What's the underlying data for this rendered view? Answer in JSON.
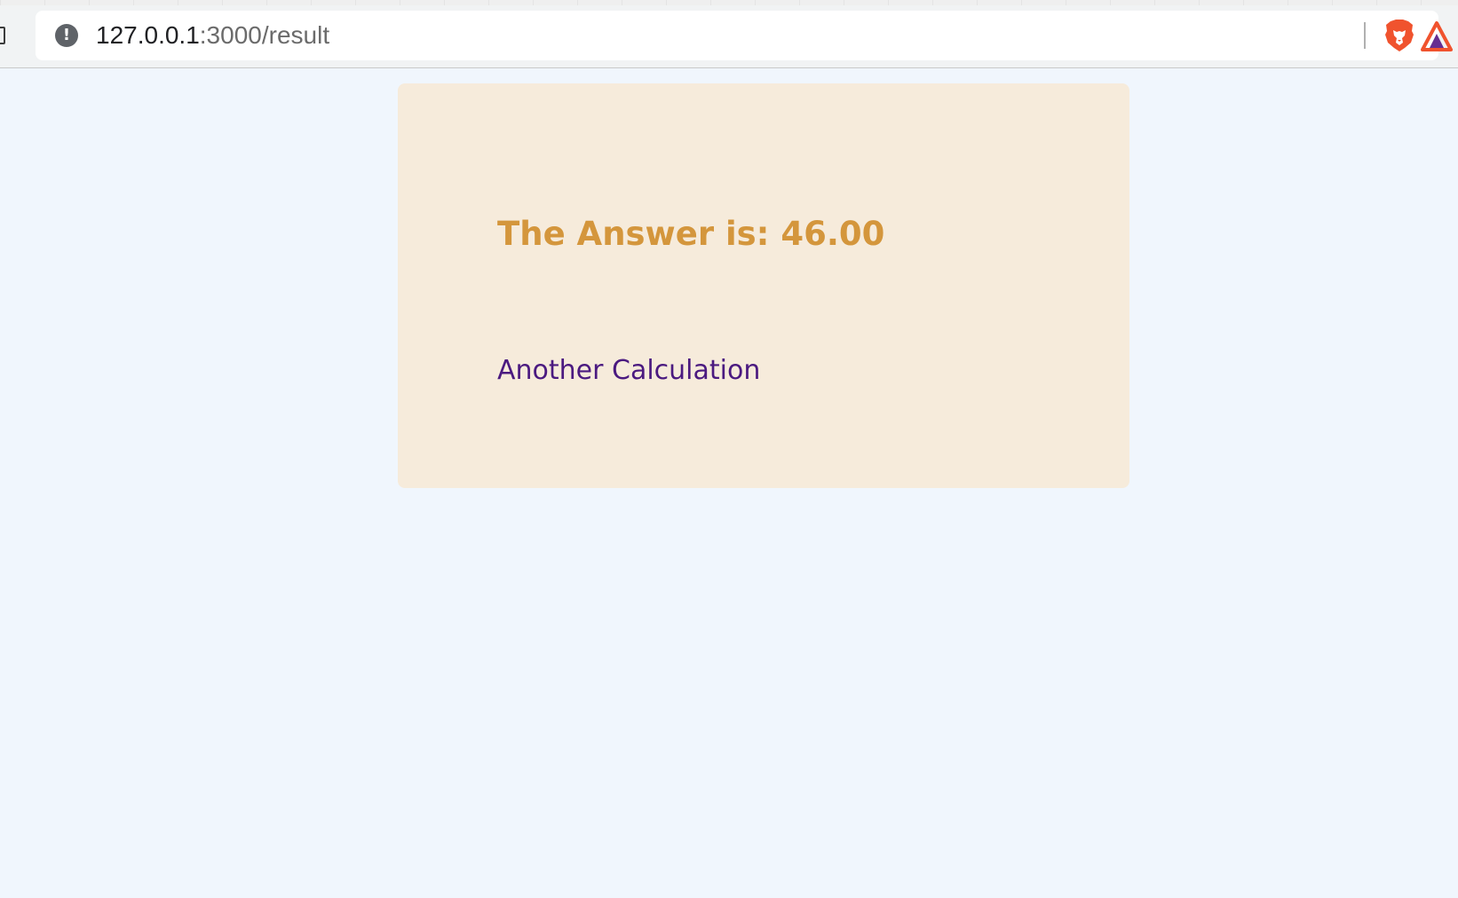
{
  "browser": {
    "url_host": "127.0.0.1",
    "url_path": ":3000/result",
    "info_icon": "info-icon",
    "info_glyph": "!",
    "extension_icons": [
      "brave-lion-icon",
      "brave-rewards-icon"
    ]
  },
  "result": {
    "answer_text": "The Answer is: 46.00",
    "link_text": "Another Calculation"
  },
  "colors": {
    "page_background": "#f0f6fd",
    "card_background": "#f6ebdb",
    "answer_color": "#d4963c",
    "link_color": "#4b1a80",
    "brave_orange": "#f0532e"
  }
}
